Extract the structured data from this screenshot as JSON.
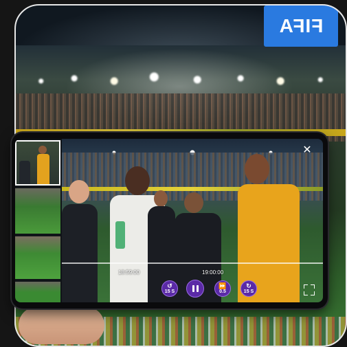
{
  "background": {
    "sign_text": "FIFA"
  },
  "player": {
    "times": {
      "left": "18:59:00",
      "right": "19:00:00"
    },
    "controls": {
      "rewind_label": "15 S",
      "forward_label": "15 S",
      "speed_label": "0.5"
    },
    "icons": {
      "close": "close-icon",
      "rewind": "rewind-15-icon",
      "pause": "pause-icon",
      "speed": "playback-speed-icon",
      "forward": "forward-15-icon",
      "fullscreen": "fullscreen-icon"
    },
    "colors": {
      "control_bg": "#5a2aa6",
      "control_border": "#9a6ae6"
    }
  }
}
